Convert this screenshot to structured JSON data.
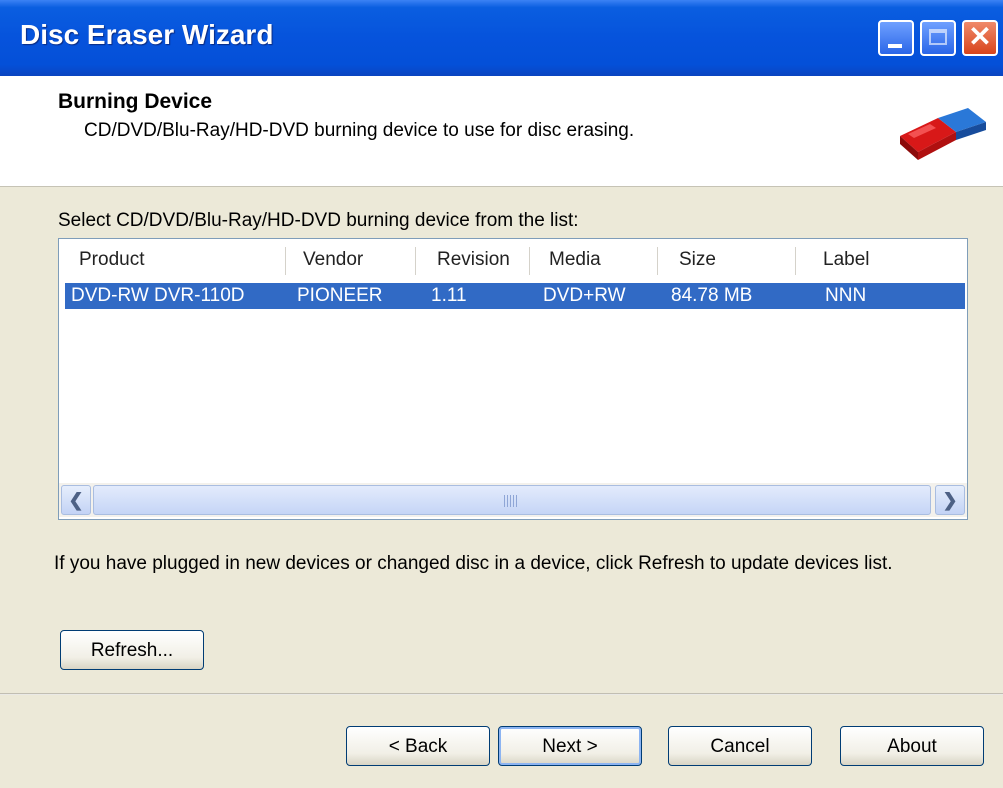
{
  "window": {
    "title": "Disc Eraser Wizard"
  },
  "header": {
    "title": "Burning Device",
    "subtitle": "CD/DVD/Blu-Ray/HD-DVD burning device to use for disc erasing."
  },
  "body": {
    "select_label": "Select CD/DVD/Blu-Ray/HD-DVD burning device from the list:",
    "info_text": "If you have plugged in new devices or changed disc in a device, click Refresh to update devices list."
  },
  "device_list": {
    "columns": [
      "Product",
      "Vendor",
      "Revision",
      "Media",
      "Size",
      "Label"
    ],
    "rows": [
      {
        "product": "DVD-RW  DVR-110D",
        "vendor": "PIONEER",
        "revision": "1.11",
        "media": "DVD+RW",
        "size": "84.78 MB",
        "label": "NNN",
        "selected": true
      }
    ]
  },
  "buttons": {
    "refresh": "Refresh...",
    "back": "< Back",
    "next": "Next >",
    "cancel": "Cancel",
    "about": "About"
  },
  "icons": {
    "app_logo": "eraser-icon",
    "minimize": "minimize-icon",
    "maximize": "maximize-icon",
    "close": "close-icon"
  },
  "colors": {
    "titlebar": "#0a5ee0",
    "selection": "#316ac5",
    "dialog_bg": "#ece9d8"
  }
}
